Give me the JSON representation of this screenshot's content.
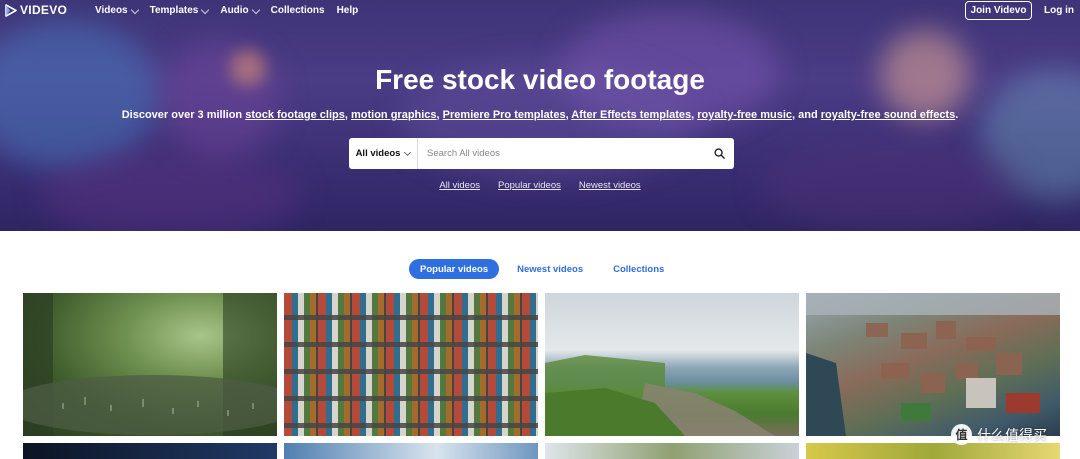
{
  "nav": {
    "logo": "VIDEVO",
    "items": [
      {
        "label": "Videos",
        "has_dropdown": true
      },
      {
        "label": "Templates",
        "has_dropdown": true
      },
      {
        "label": "Audio",
        "has_dropdown": true
      },
      {
        "label": "Collections",
        "has_dropdown": false
      },
      {
        "label": "Help",
        "has_dropdown": false
      }
    ],
    "join_label": "Join Videvo",
    "login_label": "Log in"
  },
  "hero": {
    "title": "Free stock video footage",
    "subtitle": {
      "prefix": "Discover over 3 million ",
      "link1": "stock footage clips",
      "sep1": ", ",
      "link2": "motion graphics",
      "sep2": ", ",
      "link3": "Premiere Pro templates",
      "sep3": ", ",
      "link4": "After Effects templates",
      "sep4": ", ",
      "link5": "royalty-free music",
      "sep5": ", and ",
      "link6": "royalty-free sound effects",
      "suffix": "."
    },
    "search": {
      "category": "All videos",
      "placeholder": "Search All videos",
      "icon": "search-icon"
    },
    "quick_links": [
      "All videos",
      "Popular videos",
      "Newest videos"
    ]
  },
  "tabs": [
    {
      "label": "Popular videos",
      "active": true
    },
    {
      "label": "Newest videos",
      "active": false
    },
    {
      "label": "Collections",
      "active": false
    }
  ],
  "colors": {
    "accent": "#2f6fe0",
    "hero": "#4b3c86"
  },
  "watermark": {
    "badge": "值",
    "text": "什么值得买"
  }
}
